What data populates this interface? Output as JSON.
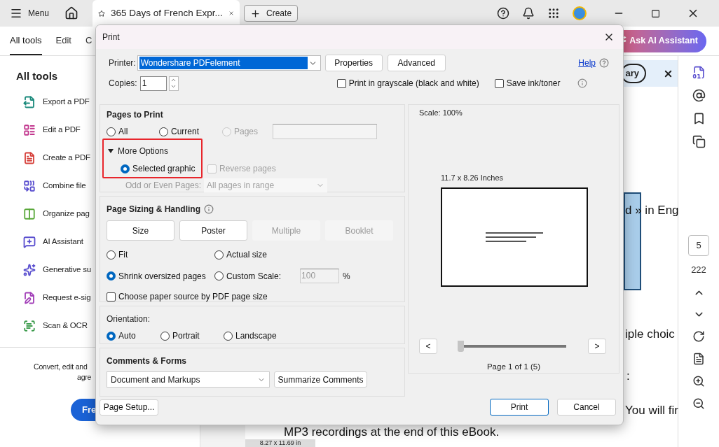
{
  "titlebar": {
    "menu": "Menu",
    "document_tab": "365 Days of French Expr...",
    "create": "Create"
  },
  "toolbar": {
    "tabs": [
      {
        "label": "All tools",
        "selected": true
      },
      {
        "label": "Edit",
        "selected": false
      },
      {
        "label": "C",
        "selected": false
      }
    ],
    "ai_button": "Ask AI Assistant"
  },
  "sidebar": {
    "title": "All tools",
    "items": [
      {
        "label": "Export a PDF",
        "color": "#1b8a7c"
      },
      {
        "label": "Edit a PDF",
        "color": "#c2378e"
      },
      {
        "label": "Create a PDF",
        "color": "#d6403a"
      },
      {
        "label": "Combine file",
        "color": "#5a4fcf"
      },
      {
        "label": "Organize pag",
        "color": "#5aa83a"
      },
      {
        "label": "AI Assistant",
        "color": "#5a4fcf"
      },
      {
        "label": "Generative su",
        "color": "#5a4fcf"
      },
      {
        "label": "Request e-sig",
        "color": "#a23fb8"
      },
      {
        "label": "Scan & OCR",
        "color": "#3a9a4a"
      }
    ],
    "promo": [
      "Convert, edit and",
      "agre"
    ],
    "promo_button": "Fre"
  },
  "document": {
    "summary_button": "ary",
    "lines": [
      "d » in Eng",
      "iple choic",
      ":",
      "You will fir"
    ],
    "bottom_line": "MP3 recordings at the end of this eBook.",
    "page_size": "8.27 x 11.69 in"
  },
  "right_rail": {
    "page_input": "5",
    "page_count": "222"
  },
  "print_dialog": {
    "title": "Print",
    "printer_label": "Printer:",
    "printer": "Wondershare PDFelement",
    "properties_button": "Properties",
    "advanced_button": "Advanced",
    "help_link": "Help",
    "copies_label": "Copies:",
    "copies": "1",
    "options": [
      {
        "label": "Print in grayscale (black and white)",
        "checked": false
      },
      {
        "label": "Save ink/toner",
        "checked": false
      }
    ],
    "pages_to_print": {
      "title": "Pages to Print",
      "ranges": [
        {
          "label": "All",
          "selected": false,
          "disabled": false
        },
        {
          "label": "Current",
          "selected": false,
          "disabled": false
        },
        {
          "label": "Pages",
          "selected": false,
          "disabled": true
        }
      ],
      "more_options": {
        "label": "More Options",
        "expanded": true
      },
      "selected_graphic": {
        "label": "Selected graphic",
        "selected": true
      },
      "reverse_pages": {
        "label": "Reverse pages",
        "checked": false,
        "disabled": true
      },
      "odd_even_label": "Odd or Even Pages:",
      "odd_even_value": "All pages in range"
    },
    "page_sizing": {
      "title": "Page Sizing & Handling",
      "modes": [
        {
          "label": "Size",
          "disabled": false
        },
        {
          "label": "Poster",
          "disabled": false
        },
        {
          "label": "Multiple",
          "disabled": true
        },
        {
          "label": "Booklet",
          "disabled": true
        }
      ],
      "scaling": [
        {
          "label": "Fit",
          "selected": false
        },
        {
          "label": "Actual size",
          "selected": false
        },
        {
          "label": "Shrink oversized pages",
          "selected": true
        },
        {
          "label": "Custom Scale:",
          "selected": false,
          "value": "100",
          "unit": "%"
        }
      ],
      "paper_source": {
        "label": "Choose paper source by PDF page size",
        "checked": false
      }
    },
    "orientation": {
      "title": "Orientation:",
      "options": [
        {
          "label": "Auto",
          "selected": true
        },
        {
          "label": "Portrait",
          "selected": false
        },
        {
          "label": "Landscape",
          "selected": false
        }
      ]
    },
    "comments_forms": {
      "title": "Comments & Forms",
      "value": "Document and Markups",
      "summarize_button": "Summarize Comments"
    },
    "preview": {
      "scale": "Scale: 100%",
      "paper": "11.7 x 8.26 Inches",
      "prev": "<",
      "next": ">",
      "page_slider": {
        "level": 0
      },
      "page_info": "Page 1 of 1 (5)"
    },
    "page_setup_button": "Page Setup...",
    "print_button": "Print",
    "cancel_button": "Cancel"
  }
}
